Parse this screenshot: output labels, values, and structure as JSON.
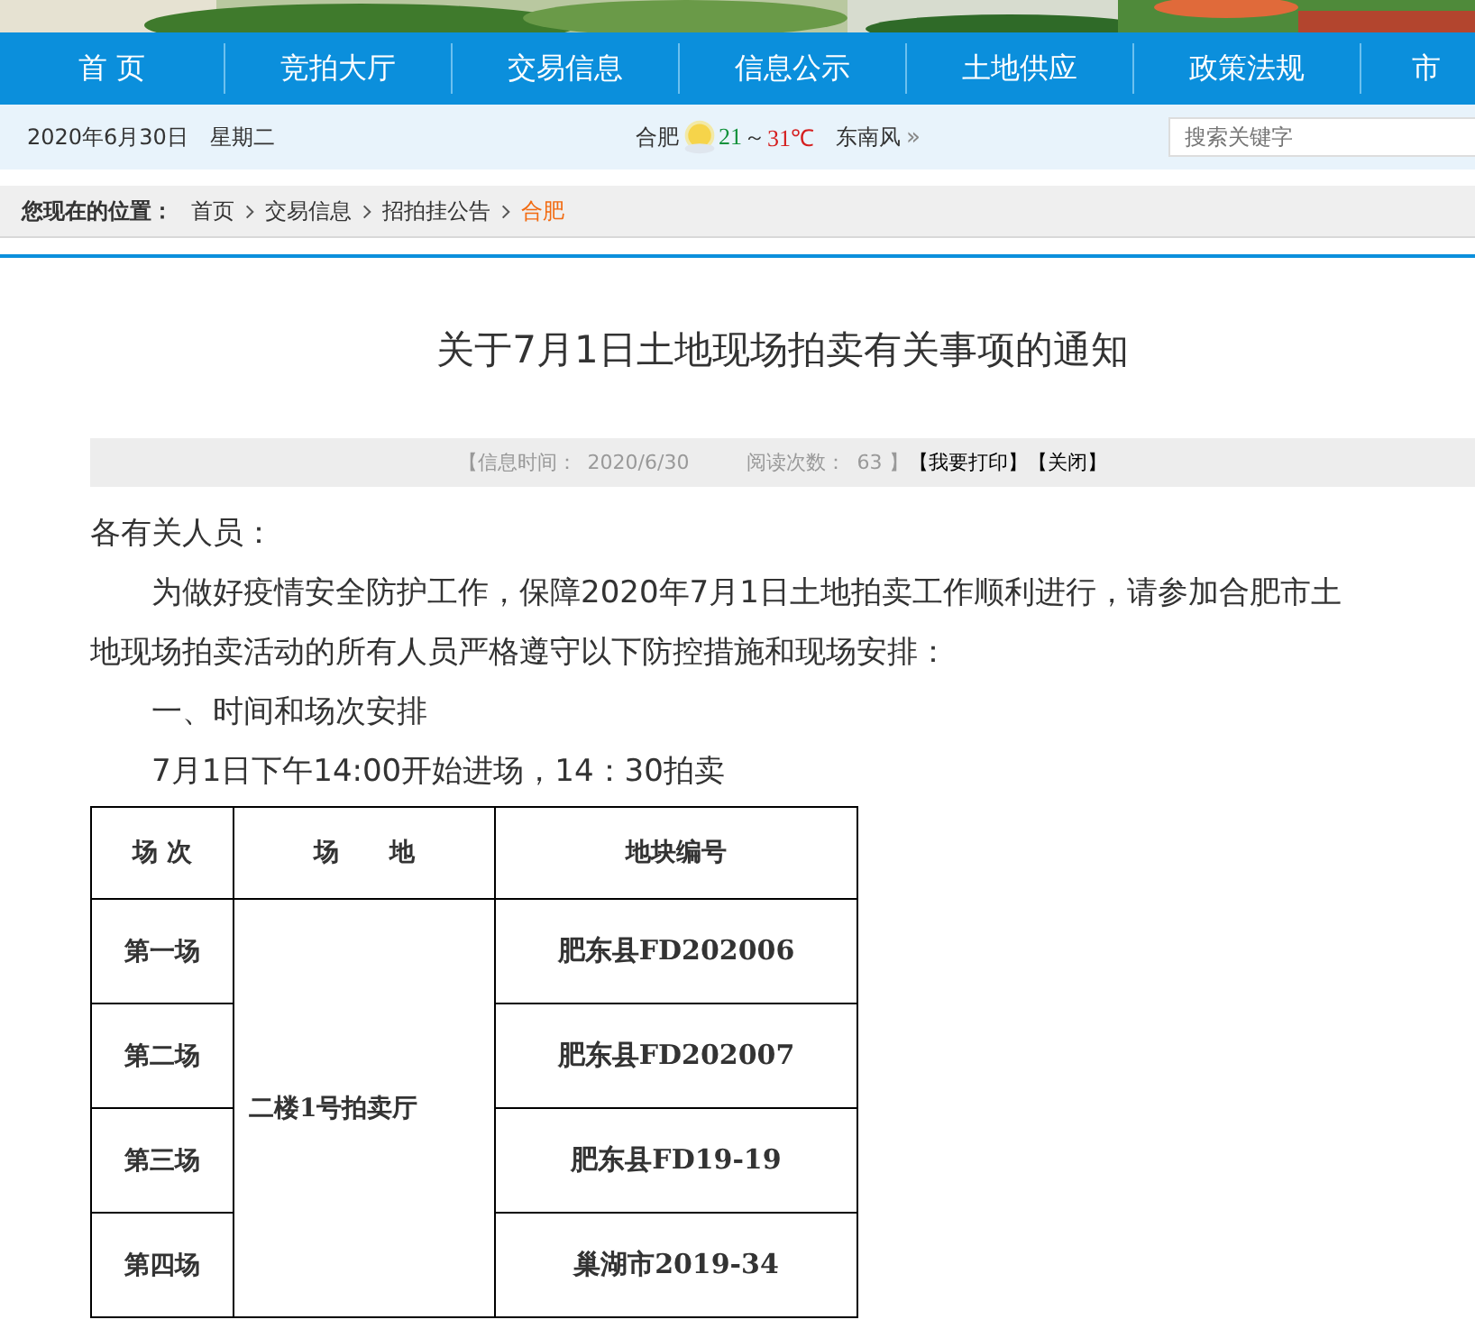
{
  "nav": [
    {
      "label": "首 页"
    },
    {
      "label": "竞拍大厅"
    },
    {
      "label": "交易信息"
    },
    {
      "label": "信息公示"
    },
    {
      "label": "土地供应"
    },
    {
      "label": "政策法规"
    },
    {
      "label": "市"
    }
  ],
  "info_bar": {
    "date": "2020年6月30日",
    "weekday": "星期二",
    "city": "合肥",
    "temp_low": "21",
    "separator": "～",
    "temp_high": "31℃",
    "wind": "东南风",
    "more": "»",
    "search": {
      "placeholder": "搜索关键字"
    }
  },
  "breadcrumb": {
    "label": "您现在的位置：",
    "items": [
      {
        "text": "首页",
        "current": false
      },
      {
        "text": "交易信息",
        "current": false
      },
      {
        "text": "招拍挂公告",
        "current": false
      },
      {
        "text": "合肥",
        "current": true
      }
    ]
  },
  "article": {
    "title": "关于7月1日土地现场拍卖有关事项的通知",
    "meta": {
      "time_label": "【信息时间：",
      "time": "2020/6/30",
      "reads_label": "阅读次数：",
      "reads": "63",
      "reads_end": "】",
      "actions": [
        "【我要打印】",
        "【关闭】"
      ]
    },
    "paragraphs": [
      {
        "text": "各有关人员：",
        "indent": false
      },
      {
        "text": "为做好疫情安全防护工作，保障2020年7月1日土地拍卖工作顺利进行，请参加合肥市土地现场拍卖活动的所有人员严格遵守以下防控措施和现场安排：",
        "indent": true
      },
      {
        "text": "一、时间和场次安排",
        "indent": true
      },
      {
        "text": "7月1日下午14:00开始进场，14：30拍卖",
        "indent": true
      }
    ],
    "table": {
      "columns": [
        "场 次",
        "场　　地",
        "地块编号"
      ],
      "venue": "二楼1号拍卖厅",
      "rows": [
        {
          "session": "第一场",
          "parcel": "肥东县FD202006"
        },
        {
          "session": "第二场",
          "parcel": "肥东县FD202007"
        },
        {
          "session": "第三场",
          "parcel": "肥东县FD19-19"
        },
        {
          "session": "第四场",
          "parcel": "巢湖市2019-34"
        }
      ]
    }
  }
}
